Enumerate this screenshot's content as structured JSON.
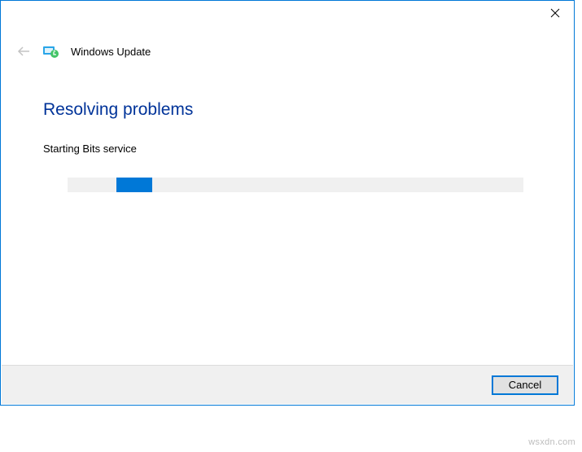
{
  "header": {
    "title": "Windows Update"
  },
  "content": {
    "heading": "Resolving problems",
    "status": "Starting Bits service"
  },
  "footer": {
    "cancel_label": "Cancel"
  },
  "watermark": "wsxdn.com"
}
